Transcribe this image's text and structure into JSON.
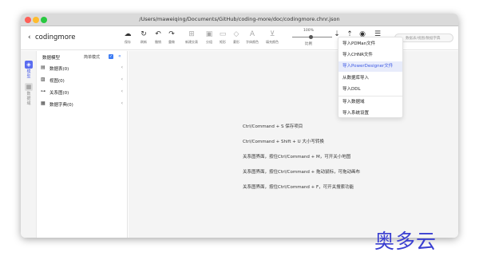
{
  "window": {
    "title": "/Users/maweiqing/Documents/GitHub/coding-more/doc/codingmore.chnr.json"
  },
  "toolbar": {
    "back_icon": "‹",
    "brand": "codingmore",
    "items": [
      {
        "icon": "☁",
        "label": "保存",
        "light": false
      },
      {
        "icon": "↻",
        "label": "刷新",
        "light": false
      },
      {
        "icon": "↶",
        "label": "撤销",
        "light": false
      },
      {
        "icon": "↷",
        "label": "重做",
        "light": false
      },
      {
        "icon": "⊞",
        "label": "新建交表",
        "light": true
      },
      {
        "icon": "▣",
        "label": "分组",
        "light": true
      },
      {
        "icon": "▭",
        "label": "矩形",
        "light": true
      },
      {
        "icon": "◇",
        "label": "菱形",
        "light": true
      },
      {
        "icon": "A",
        "label": "字体颜色",
        "light": true
      },
      {
        "icon": "⊻",
        "label": "填充颜色",
        "light": true
      },
      {
        "icon": "⇣",
        "label": "",
        "light": false
      },
      {
        "icon": "⇡",
        "label": "",
        "light": false
      },
      {
        "icon": "◉",
        "label": "",
        "light": false
      },
      {
        "icon": "☰",
        "label": "",
        "light": false
      }
    ],
    "zoom": {
      "value": "100%",
      "label": "比例"
    },
    "search": {
      "placeholder": "数据表/视图/数据字典"
    }
  },
  "rail": {
    "items": [
      {
        "label": "模型",
        "icon": "◈",
        "active": true
      },
      {
        "label": "数据域",
        "icon": "▦",
        "active": false
      }
    ]
  },
  "sidebar": {
    "header": "数据模型",
    "mode_label": "简单模式",
    "check": "✓",
    "collapse": "«",
    "items": [
      {
        "icon": "▤",
        "label": "数据表(0)"
      },
      {
        "icon": "▨",
        "label": "视图(0)"
      },
      {
        "icon": "⊶",
        "label": "关系图(0)"
      },
      {
        "icon": "▦",
        "label": "数据字典(0)"
      }
    ]
  },
  "canvas": {
    "tips": [
      "Ctrl/Command + S 保存项目",
      "Ctrl/Command + Shift + U 大小写转换",
      "关系图界面，按住Ctrl/Command + M，可开关小地图",
      "关系图界面，按住Ctrl/Command + 拖动鼠标，可拖动画布",
      "关系图界面，按住Ctrl/Command + F，可开关搜索功能"
    ]
  },
  "import_menu": {
    "items": [
      {
        "label": "导入PDMan文件",
        "highlight": false
      },
      {
        "label": "导入CHNR文件",
        "highlight": false
      },
      {
        "label": "导入PowerDesigner文件",
        "highlight": true
      },
      {
        "label": "从数据库导入",
        "highlight": false
      },
      {
        "label": "导入DDL",
        "highlight": false
      },
      {
        "label": "导入数据域",
        "highlight": false
      },
      {
        "label": "导入系统设置",
        "highlight": false
      }
    ]
  },
  "watermark": "奥多云"
}
